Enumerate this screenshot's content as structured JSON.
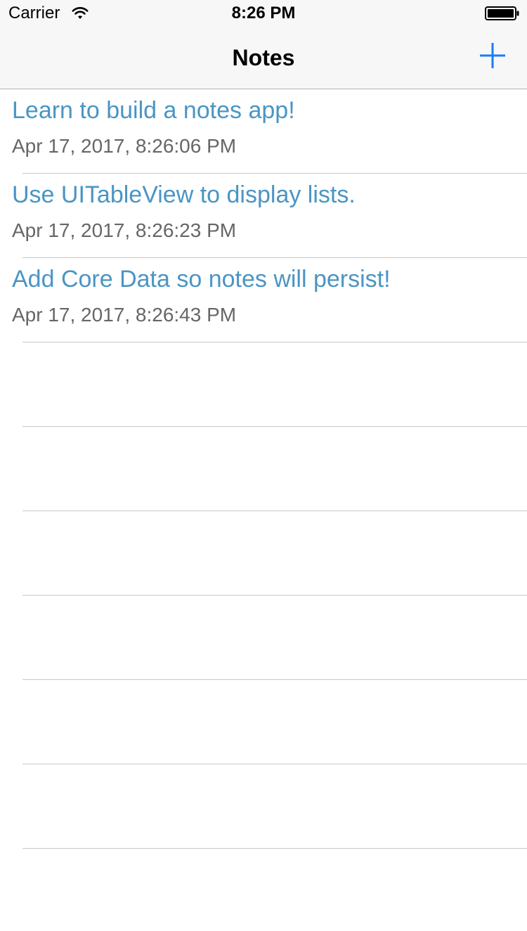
{
  "status_bar": {
    "carrier": "Carrier",
    "time": "8:26 PM"
  },
  "nav": {
    "title": "Notes",
    "add_icon": "plus-icon",
    "accent_color": "#1a7cf5"
  },
  "notes": [
    {
      "title": "Learn to build a notes app!",
      "date": "Apr 17, 2017, 8:26:06 PM"
    },
    {
      "title": "Use UITableView to display lists.",
      "date": "Apr 17, 2017, 8:26:23 PM"
    },
    {
      "title": "Add Core Data so notes will persist!",
      "date": "Apr 17, 2017, 8:26:43 PM"
    }
  ],
  "colors": {
    "note_title": "#4a95c4",
    "note_date": "#666666",
    "separator": "#c8c7cc"
  }
}
